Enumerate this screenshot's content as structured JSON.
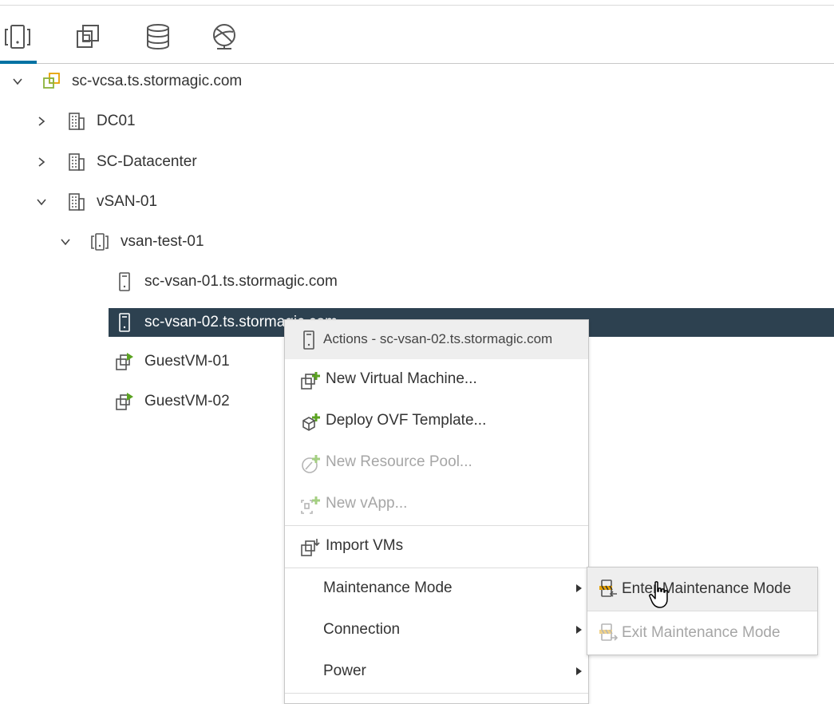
{
  "tabs": [
    {
      "name": "hosts-and-clusters",
      "icon": "hosts-clusters-icon"
    },
    {
      "name": "vms-and-templates",
      "icon": "vms-templates-icon"
    },
    {
      "name": "storage",
      "icon": "database-icon"
    },
    {
      "name": "networking",
      "icon": "network-globe-icon"
    }
  ],
  "tree": {
    "vcenter": "sc-vcsa.ts.stormagic.com",
    "dc01": "DC01",
    "sc_datacenter": "SC-Datacenter",
    "vsan01": "vSAN-01",
    "cluster": "vsan-test-01",
    "host1": "sc-vsan-01.ts.stormagic.com",
    "host2": "sc-vsan-02.ts.stormagic.com",
    "vm1": "GuestVM-01",
    "vm2": "GuestVM-02"
  },
  "context_menu": {
    "header": "Actions - sc-vsan-02.ts.stormagic.com",
    "new_vm": "New Virtual Machine...",
    "deploy_ovf": "Deploy OVF Template...",
    "new_resource_pool": "New Resource Pool...",
    "new_vapp": "New vApp...",
    "import_vms": "Import VMs",
    "maintenance_mode": "Maintenance Mode",
    "connection": "Connection",
    "power": "Power"
  },
  "submenu": {
    "enter": "Enter Maintenance Mode",
    "exit": "Exit Maintenance Mode"
  },
  "colors": {
    "selected_row": "#2d4150",
    "tab_accent": "#0072a3",
    "add_plus": "#5aa220",
    "vm_play": "#5aa220",
    "disabled_text": "#a6a6a6"
  }
}
